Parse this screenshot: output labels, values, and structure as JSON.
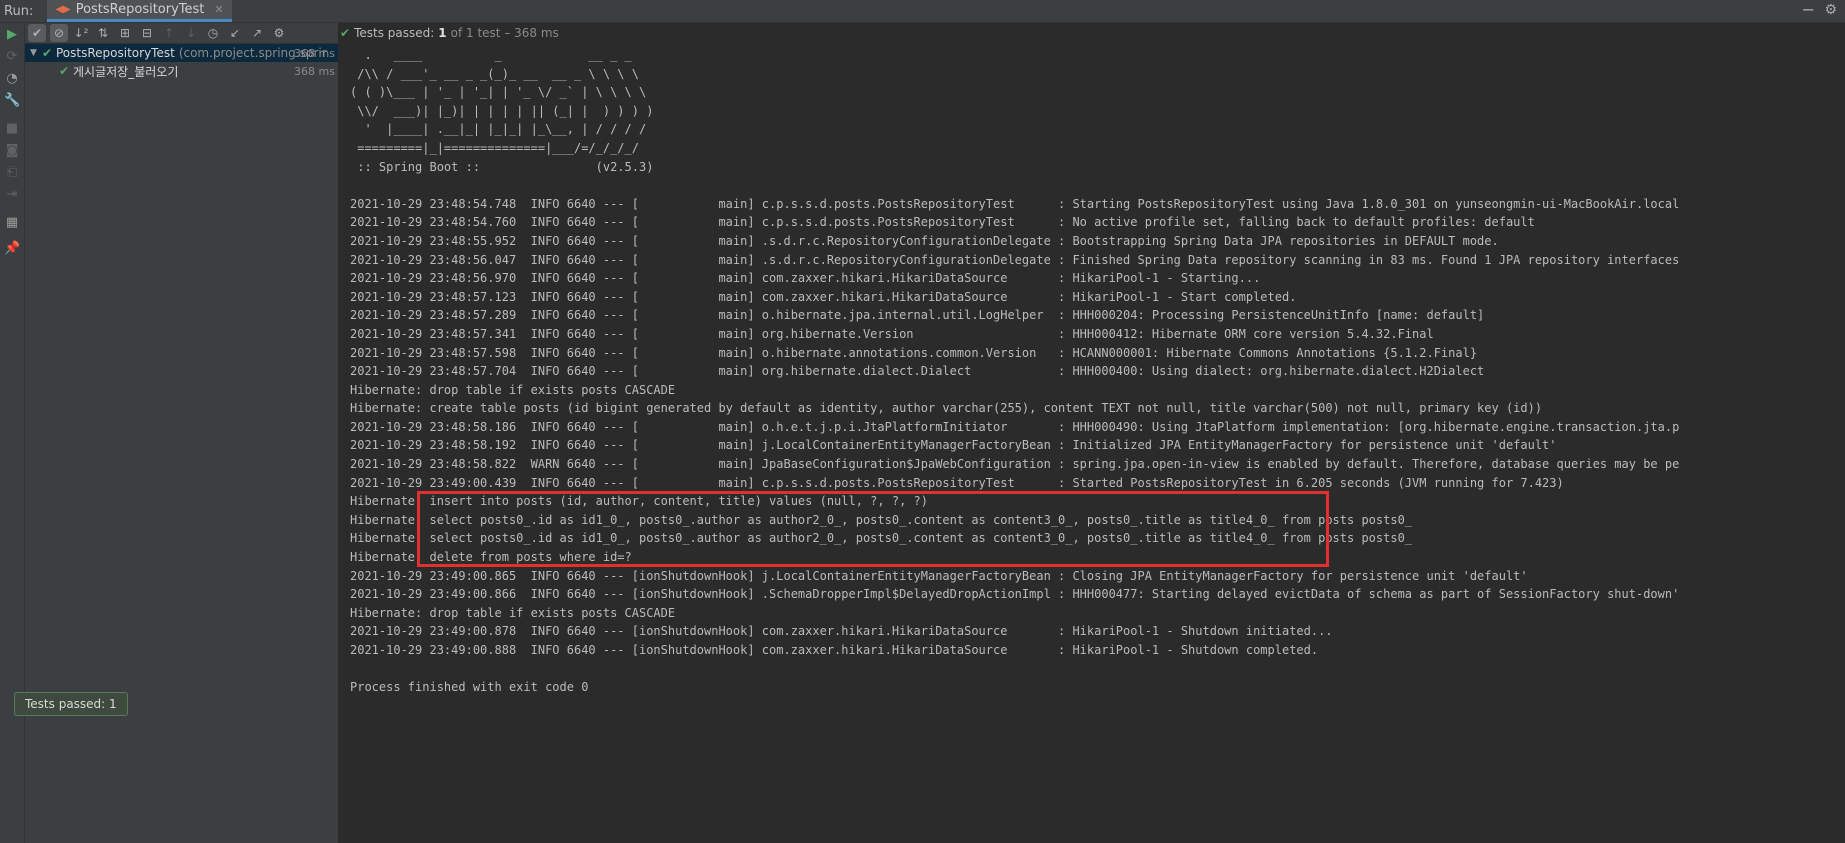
{
  "runbar": {
    "label": "Run:",
    "tab_title": "PostsRepositoryTest",
    "tab_icon": "test-run-icon"
  },
  "tree": {
    "root": {
      "name": "PostsRepositoryTest",
      "package": "(com.project.spring.sprir",
      "time": "368 ms"
    },
    "child": {
      "name": "게시글저장_불러오기",
      "time": "368 ms"
    }
  },
  "status": {
    "label": "Tests passed:",
    "passed": "1",
    "rest": "of 1 test – 368 ms"
  },
  "toast": "Tests passed: 1",
  "console_lines": [
    "  .   ____          _            __ _ _",
    " /\\\\ / ___'_ __ _ _(_)_ __  __ _ \\ \\ \\ \\",
    "( ( )\\___ | '_ | '_| | '_ \\/ _` | \\ \\ \\ \\",
    " \\\\/  ___)| |_)| | | | | || (_| |  ) ) ) )",
    "  '  |____| .__|_| |_|_| |_\\__, | / / / /",
    " =========|_|==============|___/=/_/_/_/",
    " :: Spring Boot ::                (v2.5.3)",
    "",
    "2021-10-29 23:48:54.748  INFO 6640 --- [           main] c.p.s.s.d.posts.PostsRepositoryTest      : Starting PostsRepositoryTest using Java 1.8.0_301 on yunseongmin-ui-MacBookAir.local",
    "2021-10-29 23:48:54.760  INFO 6640 --- [           main] c.p.s.s.d.posts.PostsRepositoryTest      : No active profile set, falling back to default profiles: default",
    "2021-10-29 23:48:55.952  INFO 6640 --- [           main] .s.d.r.c.RepositoryConfigurationDelegate : Bootstrapping Spring Data JPA repositories in DEFAULT mode.",
    "2021-10-29 23:48:56.047  INFO 6640 --- [           main] .s.d.r.c.RepositoryConfigurationDelegate : Finished Spring Data repository scanning in 83 ms. Found 1 JPA repository interfaces",
    "2021-10-29 23:48:56.970  INFO 6640 --- [           main] com.zaxxer.hikari.HikariDataSource       : HikariPool-1 - Starting...",
    "2021-10-29 23:48:57.123  INFO 6640 --- [           main] com.zaxxer.hikari.HikariDataSource       : HikariPool-1 - Start completed.",
    "2021-10-29 23:48:57.289  INFO 6640 --- [           main] o.hibernate.jpa.internal.util.LogHelper  : HHH000204: Processing PersistenceUnitInfo [name: default]",
    "2021-10-29 23:48:57.341  INFO 6640 --- [           main] org.hibernate.Version                    : HHH000412: Hibernate ORM core version 5.4.32.Final",
    "2021-10-29 23:48:57.598  INFO 6640 --- [           main] o.hibernate.annotations.common.Version   : HCANN000001: Hibernate Commons Annotations {5.1.2.Final}",
    "2021-10-29 23:48:57.704  INFO 6640 --- [           main] org.hibernate.dialect.Dialect            : HHH000400: Using dialect: org.hibernate.dialect.H2Dialect",
    "Hibernate: drop table if exists posts CASCADE",
    "Hibernate: create table posts (id bigint generated by default as identity, author varchar(255), content TEXT not null, title varchar(500) not null, primary key (id))",
    "2021-10-29 23:48:58.186  INFO 6640 --- [           main] o.h.e.t.j.p.i.JtaPlatformInitiator       : HHH000490: Using JtaPlatform implementation: [org.hibernate.engine.transaction.jta.p",
    "2021-10-29 23:48:58.192  INFO 6640 --- [           main] j.LocalContainerEntityManagerFactoryBean : Initialized JPA EntityManagerFactory for persistence unit 'default'",
    "2021-10-29 23:48:58.822  WARN 6640 --- [           main] JpaBaseConfiguration$JpaWebConfiguration : spring.jpa.open-in-view is enabled by default. Therefore, database queries may be pe",
    "2021-10-29 23:49:00.439  INFO 6640 --- [           main] c.p.s.s.d.posts.PostsRepositoryTest      : Started PostsRepositoryTest in 6.205 seconds (JVM running for 7.423)",
    "Hibernate: insert into posts (id, author, content, title) values (null, ?, ?, ?)",
    "Hibernate: select posts0_.id as id1_0_, posts0_.author as author2_0_, posts0_.content as content3_0_, posts0_.title as title4_0_ from posts posts0_",
    "Hibernate: select posts0_.id as id1_0_, posts0_.author as author2_0_, posts0_.content as content3_0_, posts0_.title as title4_0_ from posts posts0_",
    "Hibernate: delete from posts where id=?",
    "2021-10-29 23:49:00.865  INFO 6640 --- [ionShutdownHook] j.LocalContainerEntityManagerFactoryBean : Closing JPA EntityManagerFactory for persistence unit 'default'",
    "2021-10-29 23:49:00.866  INFO 6640 --- [ionShutdownHook] .SchemaDropperImpl$DelayedDropActionImpl : HHH000477: Starting delayed evictData of schema as part of SessionFactory shut-down'",
    "Hibernate: drop table if exists posts CASCADE",
    "2021-10-29 23:49:00.878  INFO 6640 --- [ionShutdownHook] com.zaxxer.hikari.HikariDataSource       : HikariPool-1 - Shutdown initiated...",
    "2021-10-29 23:49:00.888  INFO 6640 --- [ionShutdownHook] com.zaxxer.hikari.HikariDataSource       : HikariPool-1 - Shutdown completed.",
    "",
    "Process finished with exit code 0"
  ],
  "colors": {
    "background": "#2b2b2b",
    "panel": "#3c3f41",
    "pass_green": "#59a869",
    "highlight_red": "#e32f2f",
    "accent_blue": "#4a88c7"
  }
}
